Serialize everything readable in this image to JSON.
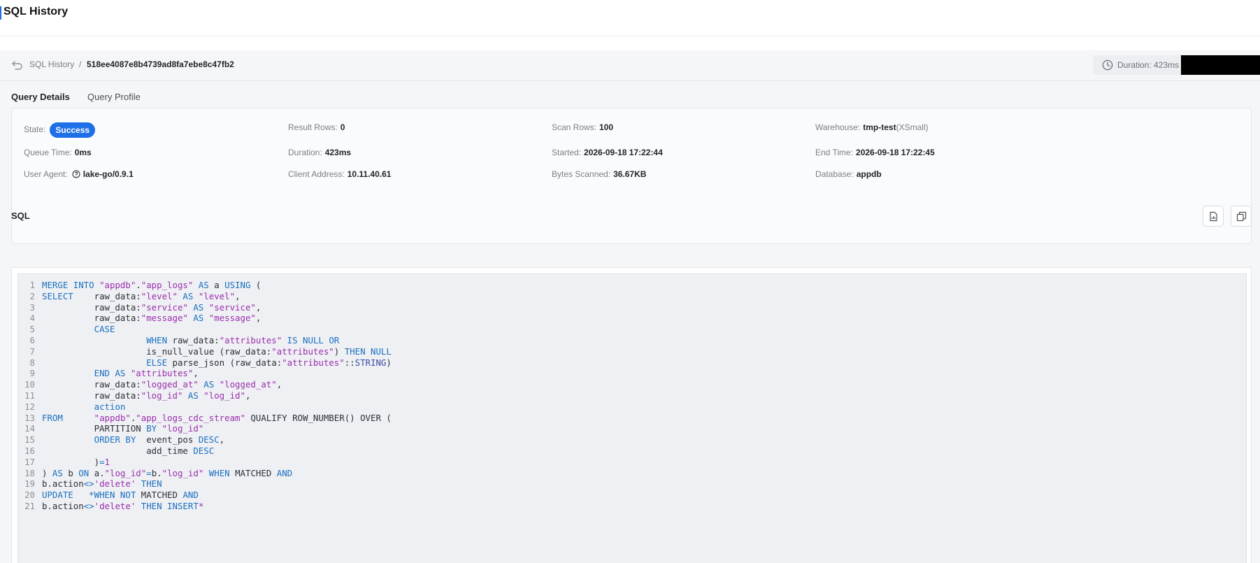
{
  "page": {
    "title": "SQL History"
  },
  "breadcrumb": {
    "root": "SQL History",
    "separator": "/",
    "query_id": "518ee4087e8b4739ad8fa7ebe8c47fb2"
  },
  "duration_pill": {
    "text": "Duration: 423ms"
  },
  "tabs": [
    {
      "label": "Query Details",
      "active": true
    },
    {
      "label": "Query Profile",
      "active": false
    }
  ],
  "details": {
    "state": {
      "label": "State:",
      "value": "Success"
    },
    "result_rows": {
      "label": "Result Rows:",
      "value": "0"
    },
    "scan_rows": {
      "label": "Scan Rows:",
      "value": "100"
    },
    "warehouse": {
      "label": "Warehouse:",
      "value": "tmp-test",
      "size": "(XSmall)"
    },
    "queue_time": {
      "label": "Queue Time:",
      "value": "0ms"
    },
    "duration": {
      "label": "Duration:",
      "value": "423ms"
    },
    "started": {
      "label": "Started:",
      "value": "2026-09-18 17:22:44"
    },
    "end_time": {
      "label": "End Time:",
      "value": "2026-09-18 17:22:45"
    },
    "user_agent": {
      "label": "User Agent:",
      "value": "lake-go/0.9.1"
    },
    "client_address": {
      "label": "Client Address:",
      "value": "10.11.40.61"
    },
    "bytes_scanned": {
      "label": "Bytes Scanned:",
      "value": "36.67KB"
    },
    "database": {
      "label": "Database:",
      "value": "appdb"
    }
  },
  "sql": {
    "title": "SQL",
    "lines": [
      [
        [
          "kw",
          "MERGE INTO "
        ],
        [
          "str",
          "\"appdb\""
        ],
        [
          "txt",
          "."
        ],
        [
          "str",
          "\"app_logs\""
        ],
        [
          "kw",
          " AS "
        ],
        [
          "txt",
          "a "
        ],
        [
          "kw",
          "USING"
        ],
        [
          "txt",
          " ("
        ]
      ],
      [
        [
          "kw",
          "SELECT"
        ],
        [
          "txt",
          "    raw_data:"
        ],
        [
          "str",
          "\"level\""
        ],
        [
          "kw",
          " AS "
        ],
        [
          "str",
          "\"level\""
        ],
        [
          "txt",
          ","
        ]
      ],
      [
        [
          "txt",
          "          raw_data:"
        ],
        [
          "str",
          "\"service\""
        ],
        [
          "kw",
          " AS "
        ],
        [
          "str",
          "\"service\""
        ],
        [
          "txt",
          ","
        ]
      ],
      [
        [
          "txt",
          "          raw_data:"
        ],
        [
          "str",
          "\"message\""
        ],
        [
          "kw",
          " AS "
        ],
        [
          "str",
          "\"message\""
        ],
        [
          "txt",
          ","
        ]
      ],
      [
        [
          "txt",
          "          "
        ],
        [
          "kw",
          "CASE"
        ]
      ],
      [
        [
          "txt",
          "                    "
        ],
        [
          "kw",
          "WHEN"
        ],
        [
          "txt",
          " raw_data:"
        ],
        [
          "str",
          "\"attributes\""
        ],
        [
          "kw",
          " IS NULL OR"
        ]
      ],
      [
        [
          "txt",
          "                    is_null_value (raw_data:"
        ],
        [
          "str",
          "\"attributes\""
        ],
        [
          "txt",
          ") "
        ],
        [
          "kw",
          "THEN NULL"
        ]
      ],
      [
        [
          "txt",
          "                    "
        ],
        [
          "kw",
          "ELSE"
        ],
        [
          "txt",
          " parse_json (raw_data:"
        ],
        [
          "str",
          "\"attributes\""
        ],
        [
          "txt",
          "::"
        ],
        [
          "dt",
          "STRING"
        ],
        [
          "txt",
          ")"
        ]
      ],
      [
        [
          "txt",
          "          "
        ],
        [
          "kw",
          "END AS "
        ],
        [
          "str",
          "\"attributes\""
        ],
        [
          "txt",
          ","
        ]
      ],
      [
        [
          "txt",
          "          raw_data:"
        ],
        [
          "str",
          "\"logged_at\""
        ],
        [
          "kw",
          " AS "
        ],
        [
          "str",
          "\"logged_at\""
        ],
        [
          "txt",
          ","
        ]
      ],
      [
        [
          "txt",
          "          raw_data:"
        ],
        [
          "str",
          "\"log_id\""
        ],
        [
          "kw",
          " AS "
        ],
        [
          "str",
          "\"log_id\""
        ],
        [
          "txt",
          ","
        ]
      ],
      [
        [
          "txt",
          "          "
        ],
        [
          "kw",
          "action"
        ]
      ],
      [
        [
          "kw",
          "FROM"
        ],
        [
          "txt",
          "      "
        ],
        [
          "str",
          "\"appdb\""
        ],
        [
          "txt",
          "."
        ],
        [
          "str",
          "\"app_logs_cdc_stream\""
        ],
        [
          "txt",
          " QUALIFY ROW_NUMBER() OVER ("
        ]
      ],
      [
        [
          "txt",
          "          PARTITION "
        ],
        [
          "kw",
          "BY "
        ],
        [
          "str",
          "\"log_id\""
        ]
      ],
      [
        [
          "txt",
          "          "
        ],
        [
          "kw",
          "ORDER BY"
        ],
        [
          "txt",
          "  event_pos "
        ],
        [
          "kw",
          "DESC"
        ],
        [
          "txt",
          ","
        ]
      ],
      [
        [
          "txt",
          "                    add_time "
        ],
        [
          "kw",
          "DESC"
        ]
      ],
      [
        [
          "txt",
          "          )"
        ],
        [
          "kw",
          "="
        ],
        [
          "str",
          "1"
        ]
      ],
      [
        [
          "txt",
          ") "
        ],
        [
          "kw",
          "AS "
        ],
        [
          "txt",
          "b "
        ],
        [
          "kw",
          "ON "
        ],
        [
          "txt",
          "a."
        ],
        [
          "str",
          "\"log_id\""
        ],
        [
          "kw",
          "="
        ],
        [
          "txt",
          "b."
        ],
        [
          "str",
          "\"log_id\""
        ],
        [
          "kw",
          " WHEN "
        ],
        [
          "txt",
          "MATCHED "
        ],
        [
          "kw",
          "AND"
        ]
      ],
      [
        [
          "txt",
          "b.action"
        ],
        [
          "kw",
          "<>"
        ],
        [
          "str",
          "'delete'"
        ],
        [
          "kw",
          " THEN"
        ]
      ],
      [
        [
          "kw",
          "UPDATE"
        ],
        [
          "txt",
          "   "
        ],
        [
          "kw",
          "*WHEN NOT "
        ],
        [
          "txt",
          "MATCHED "
        ],
        [
          "kw",
          "AND"
        ]
      ],
      [
        [
          "txt",
          "b.action"
        ],
        [
          "kw",
          "<>"
        ],
        [
          "str",
          "'delete'"
        ],
        [
          "kw",
          " THEN INSERT"
        ],
        [
          "str",
          "*"
        ]
      ]
    ]
  },
  "icons": {
    "back": "back-arrow-icon",
    "clock": "clock-icon",
    "export": "export-report-icon",
    "copy": "copy-icon",
    "help": "help-circle-icon"
  },
  "colors": {
    "accent": "#1e6fe8",
    "keyword": "#1a6fc1",
    "string": "#9b2fae"
  }
}
